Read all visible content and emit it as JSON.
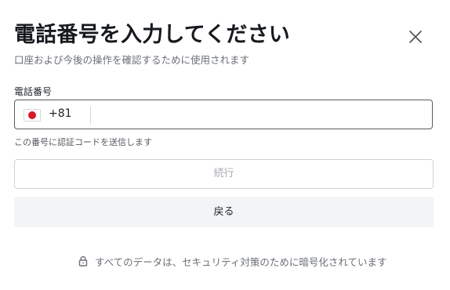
{
  "dialog": {
    "title": "電話番号を入力してください",
    "subtitle": "口座および今後の操作を確認するために使用されます",
    "close_icon": "close-icon"
  },
  "phone_field": {
    "label": "電話番号",
    "country_flag": "japan-flag-icon",
    "country_code": "+81",
    "value": "",
    "placeholder": "",
    "helper_text": "この番号に認証コードを送信します"
  },
  "buttons": {
    "continue_label": "続行",
    "back_label": "戻る"
  },
  "footer": {
    "lock_icon": "lock-icon",
    "security_text": "すべてのデータは、セキュリティ対策のために暗号化されています"
  },
  "colors": {
    "flag_red": "#d61a2b",
    "input_border": "#55595f",
    "disabled_text": "#a9adb3",
    "back_button_bg": "#f3f4f5"
  }
}
